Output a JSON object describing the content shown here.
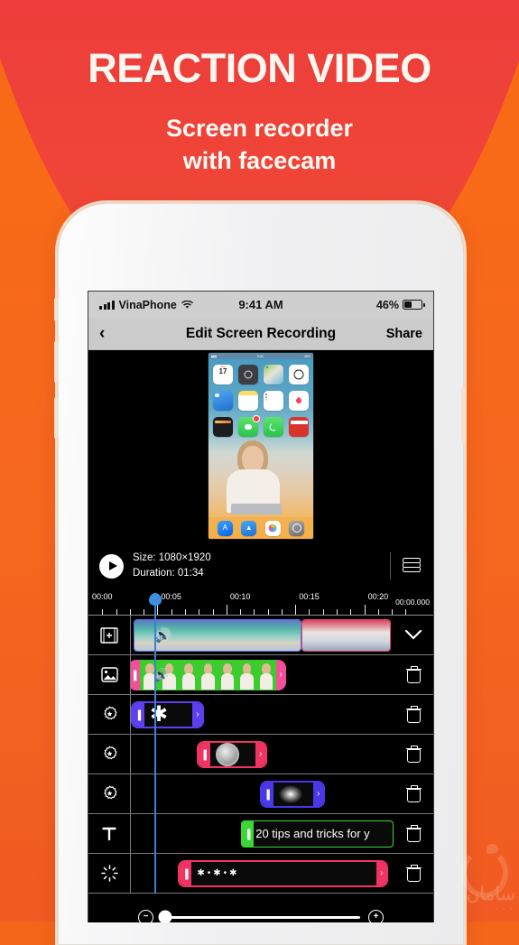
{
  "promo": {
    "title": "REACTION VIDEO",
    "subtitle_line1": "Screen recorder",
    "subtitle_line2": "with facecam",
    "bg_color": "#f5661f",
    "arc_color": "#ef3b3e",
    "text_color": "#fdf6ef"
  },
  "status_bar": {
    "carrier": "VinaPhone",
    "wifi_icon": "wifi-icon",
    "time": "9:41 AM",
    "battery_percent": "46%"
  },
  "nav_bar": {
    "back_icon": "chevron-left-icon",
    "title": "Edit Screen Recording",
    "share_label": "Share"
  },
  "preview": {
    "home_screen_apps": [
      {
        "name": "Calendar",
        "day": "17",
        "color": "#ffffff"
      },
      {
        "name": "Camera",
        "color": "#3d3d42"
      },
      {
        "name": "Maps",
        "color": "#8ec65a"
      },
      {
        "name": "Clock",
        "color": "#ffffff"
      },
      {
        "name": "Weather",
        "color": "#3a8fe0"
      },
      {
        "name": "Notes",
        "color": "#fcdf60"
      },
      {
        "name": "Reminders",
        "color": "#ffffff"
      },
      {
        "name": "Health",
        "color": "#ffffff"
      },
      {
        "name": "Wallet",
        "color": "#222228"
      },
      {
        "name": "Messages",
        "color": "#4cd964",
        "badge": "1"
      },
      {
        "name": "Phone",
        "color": "#4cd964"
      },
      {
        "name": "iMovie",
        "color": "#d8342c"
      }
    ],
    "dock_apps": [
      {
        "name": "App Store",
        "color": "#1a84f0"
      },
      {
        "name": "Files",
        "color": "#2a7de1"
      },
      {
        "name": "Photos",
        "color": "#fdfdfd"
      },
      {
        "name": "Settings",
        "color": "#8a8a8e"
      }
    ],
    "facecam_label": "facecam-overlay"
  },
  "info_bar": {
    "play_icon": "play-icon",
    "size_label": "Size: 1080×1920",
    "duration_label": "Duration: 01:34",
    "layers_icon": "layers-icon"
  },
  "timeline": {
    "ruler_labels": [
      "00:00",
      "00:05",
      "00:10",
      "00:15",
      "00:20"
    ],
    "current_time": "00:00.000",
    "playhead_position_pct": 7,
    "expand_icon": "chevron-down-icon",
    "tracks": [
      {
        "type": "video",
        "icon": "film-add-icon",
        "tail_icon": "chevron-down-icon",
        "clips": [
          {
            "label": "screen-recording-clip",
            "color": "#5d6fe8",
            "left_pct": 1,
            "width_pct": 64,
            "has_audio_icon": true
          },
          {
            "label": "second-video-clip",
            "color": "#e8415f",
            "left_pct": 65,
            "width_pct": 34,
            "has_audio_icon": false
          }
        ]
      },
      {
        "type": "image",
        "icon": "image-icon",
        "tail_icon": "trash-icon",
        "clips": [
          {
            "label": "facecam-greenscreen-clip",
            "color": "#f24f9b",
            "left_pct": -1,
            "width_pct": 60,
            "has_audio_icon": true
          }
        ]
      },
      {
        "type": "sticker",
        "icon": "sticker-icon",
        "tail_icon": "trash-icon",
        "clips": [
          {
            "label": "sparkle-sticker-clip",
            "color": "#5d3ff0",
            "left_pct": 0,
            "width_pct": 28,
            "glyph": "sparkle"
          }
        ]
      },
      {
        "type": "sticker",
        "icon": "sticker-icon",
        "tail_icon": "trash-icon",
        "clips": [
          {
            "label": "circle-sticker-clip",
            "color": "#ef3463",
            "left_pct": 25,
            "width_pct": 27,
            "glyph": "circle"
          }
        ]
      },
      {
        "type": "sticker",
        "icon": "sticker-icon",
        "tail_icon": "trash-icon",
        "clips": [
          {
            "label": "blur-sticker-clip",
            "color": "#4a38e8",
            "left_pct": 49,
            "width_pct": 25,
            "glyph": "blur"
          }
        ]
      },
      {
        "type": "text",
        "icon": "text-icon",
        "tail_icon": "trash-icon",
        "clips": [
          {
            "label": "text-clip",
            "color": "#3cd636",
            "left_pct": 42,
            "width_pct": 58,
            "text": "20 tips and tricks for y"
          }
        ]
      },
      {
        "type": "effect",
        "icon": "sparkle-icon",
        "tail_icon": "trash-icon",
        "clips": [
          {
            "label": "effect-clip",
            "color": "#ef3463",
            "left_pct": 18,
            "width_pct": 80,
            "glyph": "stars"
          }
        ]
      }
    ]
  },
  "zoom_bar": {
    "zoom_out_icon": "magnifier-minus-icon",
    "zoom_in_icon": "magnifier-plus-icon",
    "slider_value_pct": 2
  },
  "watermark": {
    "text": "سامان",
    "sub": "• • •"
  }
}
